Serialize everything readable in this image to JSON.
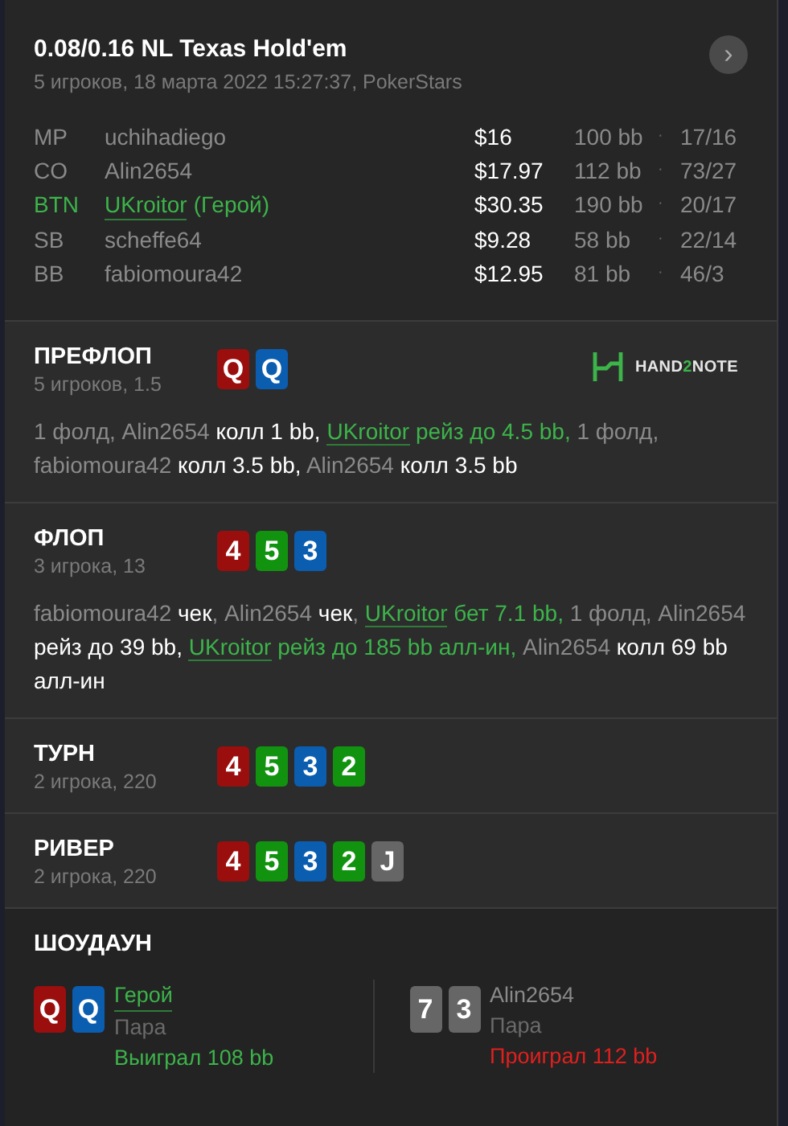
{
  "header": {
    "title": "0.08/0.16 NL Texas Hold'em",
    "subtitle": "5 игроков, 18 марта 2022 15:27:37, PokerStars",
    "next_button": "›"
  },
  "players": [
    {
      "position": "MP",
      "name": "uchihadiego",
      "hero": false,
      "stack": "$16",
      "bb": "100 bb",
      "separator": "·",
      "stats": "17/16"
    },
    {
      "position": "CO",
      "name": "Alin2654",
      "hero": false,
      "stack": "$17.97",
      "bb": "112 bb",
      "separator": "·",
      "stats": "73/27"
    },
    {
      "position": "BTN",
      "name": "UKroitor",
      "hero": true,
      "tag": "(Герой)",
      "stack": "$30.35",
      "bb": "190 bb",
      "separator": "·",
      "stats": "20/17"
    },
    {
      "position": "SB",
      "name": "scheffe64",
      "hero": false,
      "stack": "$9.28",
      "bb": "58 bb",
      "separator": "·",
      "stats": "22/14"
    },
    {
      "position": "BB",
      "name": "fabiomoura42",
      "hero": false,
      "stack": "$12.95",
      "bb": "81 bb",
      "separator": "·",
      "stats": "46/3"
    }
  ],
  "streets": [
    {
      "title": "ПРЕФЛОП",
      "info": "5 игроков, 1.5",
      "logo": {
        "before": "HAND",
        "accent": "2",
        "after": "NOTE"
      },
      "cards": [
        {
          "rank": "Q",
          "color": "#9b0e0e"
        },
        {
          "rank": "Q",
          "color": "#0b5db0"
        }
      ],
      "actions": [
        {
          "kind": "plain",
          "text": "1 фолд,"
        },
        {
          "kind": "name",
          "text": "Alin2654"
        },
        {
          "kind": "action",
          "text": "колл 1 bb,"
        },
        {
          "kind": "hero",
          "text": "UKroitor"
        },
        {
          "kind": "hero_action",
          "text": "рейз до 4.5 bb,"
        },
        {
          "kind": "plain",
          "text": "1 фолд,"
        },
        {
          "kind": "name",
          "text": "fabiomoura42"
        },
        {
          "kind": "action",
          "text": "колл 3.5 bb,"
        },
        {
          "kind": "name",
          "text": "Alin2654"
        },
        {
          "kind": "action",
          "text": "колл 3.5 bb"
        }
      ]
    },
    {
      "title": "ФЛОП",
      "info": "3 игрока, 13",
      "cards": [
        {
          "rank": "4",
          "color": "#9b0e0e"
        },
        {
          "rank": "5",
          "color": "#12930f"
        },
        {
          "rank": "3",
          "color": "#0b5db0"
        }
      ],
      "actions": [
        {
          "kind": "name",
          "text": "fabiomoura42"
        },
        {
          "kind": "action",
          "text": "чек"
        },
        {
          "kind": "plain",
          "text": ","
        },
        {
          "kind": "name",
          "text": "Alin2654"
        },
        {
          "kind": "action",
          "text": "чек"
        },
        {
          "kind": "plain",
          "text": ","
        },
        {
          "kind": "hero",
          "text": "UKroitor"
        },
        {
          "kind": "hero_action",
          "text": "бет 7.1 bb,"
        },
        {
          "kind": "plain",
          "text": "1 фолд,"
        },
        {
          "kind": "name",
          "text": "Alin2654"
        },
        {
          "kind": "action",
          "text": "рейз до 39 bb,"
        },
        {
          "kind": "hero",
          "text": "UKroitor"
        },
        {
          "kind": "hero_action",
          "text": "рейз до 185 bb алл-ин,"
        },
        {
          "kind": "name",
          "text": "Alin2654"
        },
        {
          "kind": "action",
          "text": "колл 69 bb алл-ин"
        }
      ]
    },
    {
      "title": "ТУРН",
      "info": "2 игрока, 220",
      "cards": [
        {
          "rank": "4",
          "color": "#9b0e0e"
        },
        {
          "rank": "5",
          "color": "#12930f"
        },
        {
          "rank": "3",
          "color": "#0b5db0"
        },
        {
          "rank": "2",
          "color": "#12930f"
        }
      ]
    },
    {
      "title": "РИВЕР",
      "info": "2 игрока, 220",
      "cards": [
        {
          "rank": "4",
          "color": "#9b0e0e"
        },
        {
          "rank": "5",
          "color": "#12930f"
        },
        {
          "rank": "3",
          "color": "#0b5db0"
        },
        {
          "rank": "2",
          "color": "#12930f"
        },
        {
          "rank": "J",
          "color": "#666666"
        }
      ]
    }
  ],
  "showdown": {
    "title": "ШОУДАУН",
    "hands": [
      {
        "name": "Герой",
        "hero": true,
        "won": true,
        "cards": [
          {
            "rank": "Q",
            "color": "#9b0e0e"
          },
          {
            "rank": "Q",
            "color": "#0b5db0"
          }
        ],
        "combination": "Пара",
        "result": "Выиграл 108 bb"
      },
      {
        "name": "Alin2654",
        "hero": false,
        "won": false,
        "cards": [
          {
            "rank": "7",
            "color": "#666666"
          },
          {
            "rank": "3",
            "color": "#666666"
          }
        ],
        "combination": "Пара",
        "result": "Проиграл 112 bb"
      }
    ]
  }
}
